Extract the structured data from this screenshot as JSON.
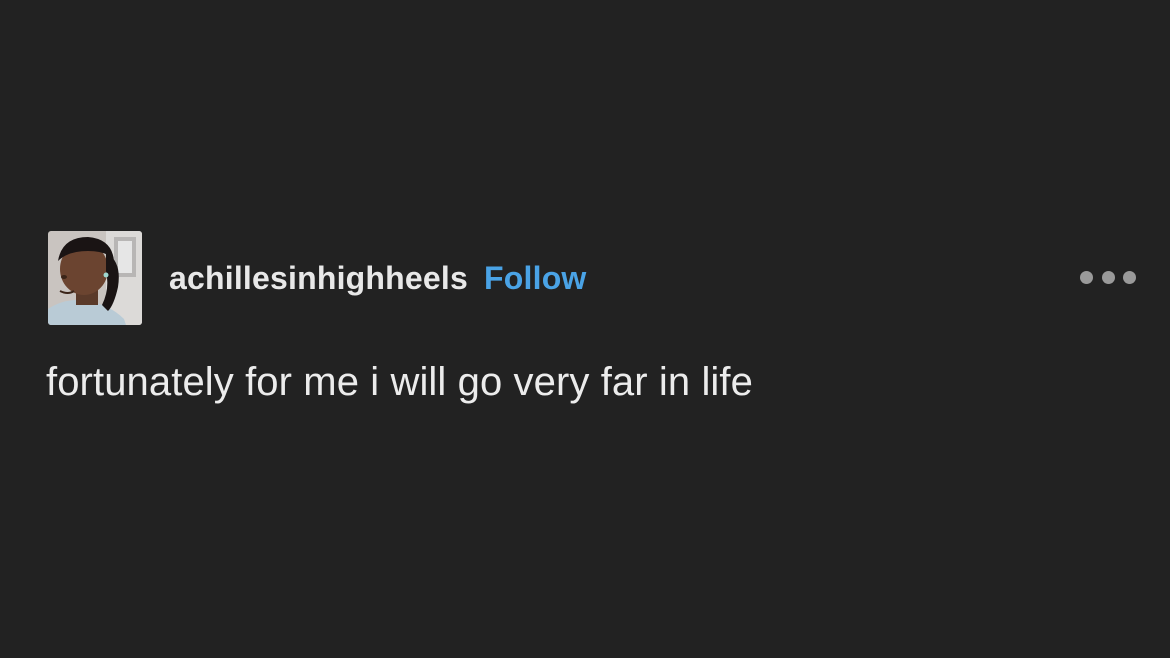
{
  "post": {
    "author": {
      "username": "achillesinhighheels",
      "avatar_icon": "profile-photo"
    },
    "follow_label": "Follow",
    "more_icon": "ellipsis-icon",
    "body_text": "fortunately for me i will go very far in life"
  },
  "colors": {
    "background": "#222222",
    "username": "#e8e8e8",
    "follow": "#4aa3e6",
    "body_text": "#ececec",
    "more_dots": "#9a9a9a"
  }
}
